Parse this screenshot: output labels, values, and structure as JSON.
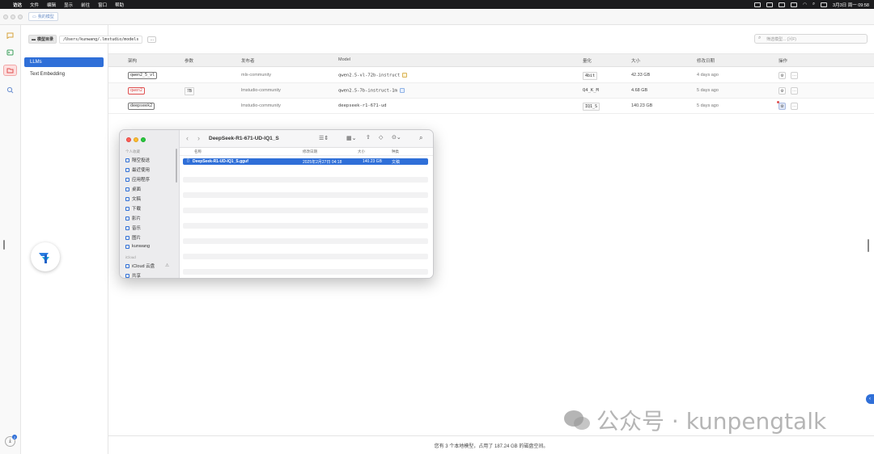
{
  "menubar": {
    "apple": "",
    "items": [
      "访达",
      "文件",
      "编辑",
      "显示",
      "前往",
      "窗口",
      "帮助"
    ],
    "datetime": "3月3日 周一 09:58"
  },
  "titlebar": {
    "tab_label": "我的模型"
  },
  "path": {
    "label": "模型目录",
    "value": "/Users/kunwang/.lmstudio/models",
    "more": "…"
  },
  "search": {
    "placeholder": "筛选模型... (⌘F)"
  },
  "sidebar": {
    "categories": [
      "LLMs",
      "Text Embedding"
    ]
  },
  "table": {
    "headers": {
      "arch": "架构",
      "params": "参数",
      "publisher": "发布者",
      "model": "Model",
      "quant": "量化",
      "size": "大小",
      "modified": "修改日期",
      "actions": "操作"
    },
    "rows": [
      {
        "arch": "qwen2_5_vl",
        "params": "",
        "publisher": "mlx-community",
        "model": "qwen2.5-vl-72b-instruct",
        "quant": "4bit",
        "size": "42.33 GB",
        "modified": "4 days ago"
      },
      {
        "arch": "qwen2",
        "params": "7B",
        "publisher": "lmstudio-community",
        "model": "qwen2.5-7b-instruct-1m",
        "quant": "Q4_K_M",
        "size": "4.68 GB",
        "modified": "5 days ago"
      },
      {
        "arch": "deepseek2",
        "params": "",
        "publisher": "lmstudio-community",
        "model": "deepseek-r1-671-ud",
        "quant": "IQ1_S",
        "size": "140.23 GB",
        "modified": "5 days ago"
      }
    ]
  },
  "finder": {
    "title": "DeepSeek-R1-671-UD-IQ1_S",
    "sidebar_section": "个人收藏",
    "sidebar_items": [
      "隔空投送",
      "最近使用",
      "应用程序",
      "桌面",
      "文稿",
      "下载",
      "影片",
      "音乐",
      "图片",
      "kunwang"
    ],
    "cloud_section": "iCloud",
    "cloud_items": [
      "iCloud 云盘",
      "共享"
    ],
    "columns": {
      "name": "名称",
      "date": "修改日期",
      "size": "大小",
      "kind": "种类"
    },
    "file": {
      "name": "DeepSeek-R1-UD-IQ1_S.gguf",
      "date": "2025年2月27日 04:18",
      "size": "140.23 GB",
      "kind": "文稿"
    }
  },
  "status": {
    "text": "您有 3 个本地模型，占用了 187.24 GB 的磁盘空间。"
  },
  "download_badge": "2",
  "watermark": {
    "text": "公众号 · kunpengtalk"
  },
  "colors": {
    "accent": "#2f6fd8",
    "danger": "#e05050"
  }
}
